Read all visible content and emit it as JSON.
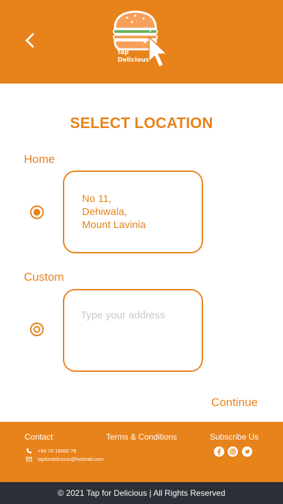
{
  "header": {
    "logo_line1": "Tap",
    "logo_line2": "Delicious",
    "back_icon": "chevron-left-icon",
    "bg_color": "#e8821a"
  },
  "page": {
    "title": "SELECT LOCATION",
    "accent_color": "#e8821a"
  },
  "home": {
    "label": "Home",
    "selected": true,
    "address_line1": "No 11,",
    "address_line2": "Dehiwala,",
    "address_line3": "Mount Lavinia"
  },
  "custom": {
    "label": "Custom",
    "selected": false,
    "value": "",
    "placeholder": "Type your address"
  },
  "actions": {
    "continue_label": "Continue"
  },
  "footer": {
    "contact_heading": "Contact",
    "terms_label": "Terms & Conditions",
    "subscribe_heading": "Subscribe Us",
    "phone": "+94 76 19000 78",
    "email": "tapfordelicious@hotmail.com",
    "social_icons": [
      "facebook-icon",
      "instagram-icon",
      "twitter-icon"
    ]
  },
  "bottom_bar": {
    "copyright": "© 2021 Tap for Delicious | All Rights Reserved",
    "bg_color": "#2b2f36"
  }
}
